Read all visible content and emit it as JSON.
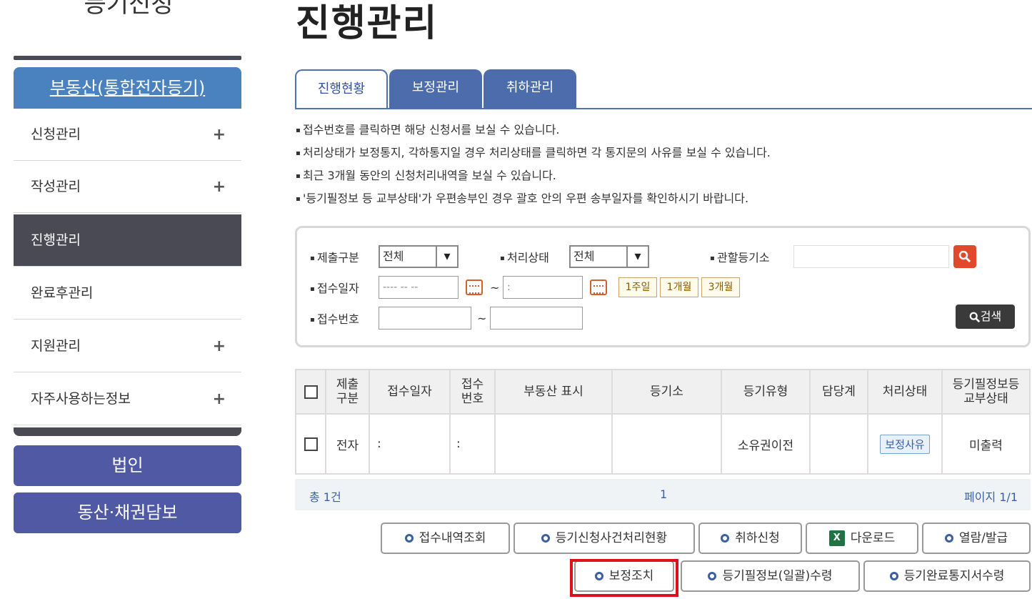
{
  "sidebar": {
    "title": "등기신청",
    "header": "부동산(통합전자등기)",
    "items": [
      {
        "label": "신청관리",
        "plus": "+"
      },
      {
        "label": "작성관리",
        "plus": "+"
      },
      {
        "label": "진행관리",
        "plus": ""
      },
      {
        "label": "완료후관리",
        "plus": ""
      },
      {
        "label": "지원관리",
        "plus": "+"
      },
      {
        "label": "자주사용하는정보",
        "plus": "+"
      }
    ],
    "corp": "법인",
    "movable": "동산·채권담보"
  },
  "page_title": "진행관리",
  "tabs": [
    "진행현황",
    "보정관리",
    "취하관리"
  ],
  "notes": [
    "접수번호를 클릭하면 해당 신청서를 보실 수 있습니다.",
    "처리상태가 보정통지, 각하통지일 경우 처리상태를 클릭하면 각 통지문의 사유를 보실 수 있습니다.",
    "최근 3개월 동안의 신청처리내역을 보실 수 있습니다.",
    "'등기필정보 등 교부상태'가 우편송부인 경우 괄호 안의 우편 송부일자를 확인하시기 바랍니다."
  ],
  "search": {
    "submit_type_label": "제출구분",
    "submit_type_value": "전체",
    "status_label": "처리상태",
    "status_value": "전체",
    "registry_label": "관할등기소",
    "date_label": "접수일자",
    "date_from": "---- -- --",
    "date_to": ":",
    "tilde": "~",
    "period_1w": "1주일",
    "period_1m": "1개월",
    "period_3m": "3개월",
    "number_label": "접수번호",
    "search_button": "검색"
  },
  "table": {
    "headers": [
      "제출\n구분",
      "접수일자",
      "접수\n번호",
      "부동산 표시",
      "등기소",
      "등기유형",
      "담당계",
      "처리상태",
      "등기필정보등\n교부상태"
    ],
    "rows": [
      {
        "submit": "전자",
        "date": ":",
        "number": ":",
        "property": "",
        "registry": "",
        "type": "소유권이전",
        "team": "",
        "status": "보정사유",
        "delivery": "미출력"
      }
    ]
  },
  "summary": {
    "total": "총 1건",
    "page_num": "1",
    "page_info": "페이지 1/1"
  },
  "actions": {
    "receipt_history": "접수내역조회",
    "process_status": "등기신청사건처리현황",
    "withdraw": "취하신청",
    "download": "다운로드",
    "view_issue": "열람/발급",
    "correction": "보정조치",
    "receive_info": "등기필정보(일괄)수령",
    "receive_notice": "등기완료통지서수령"
  }
}
